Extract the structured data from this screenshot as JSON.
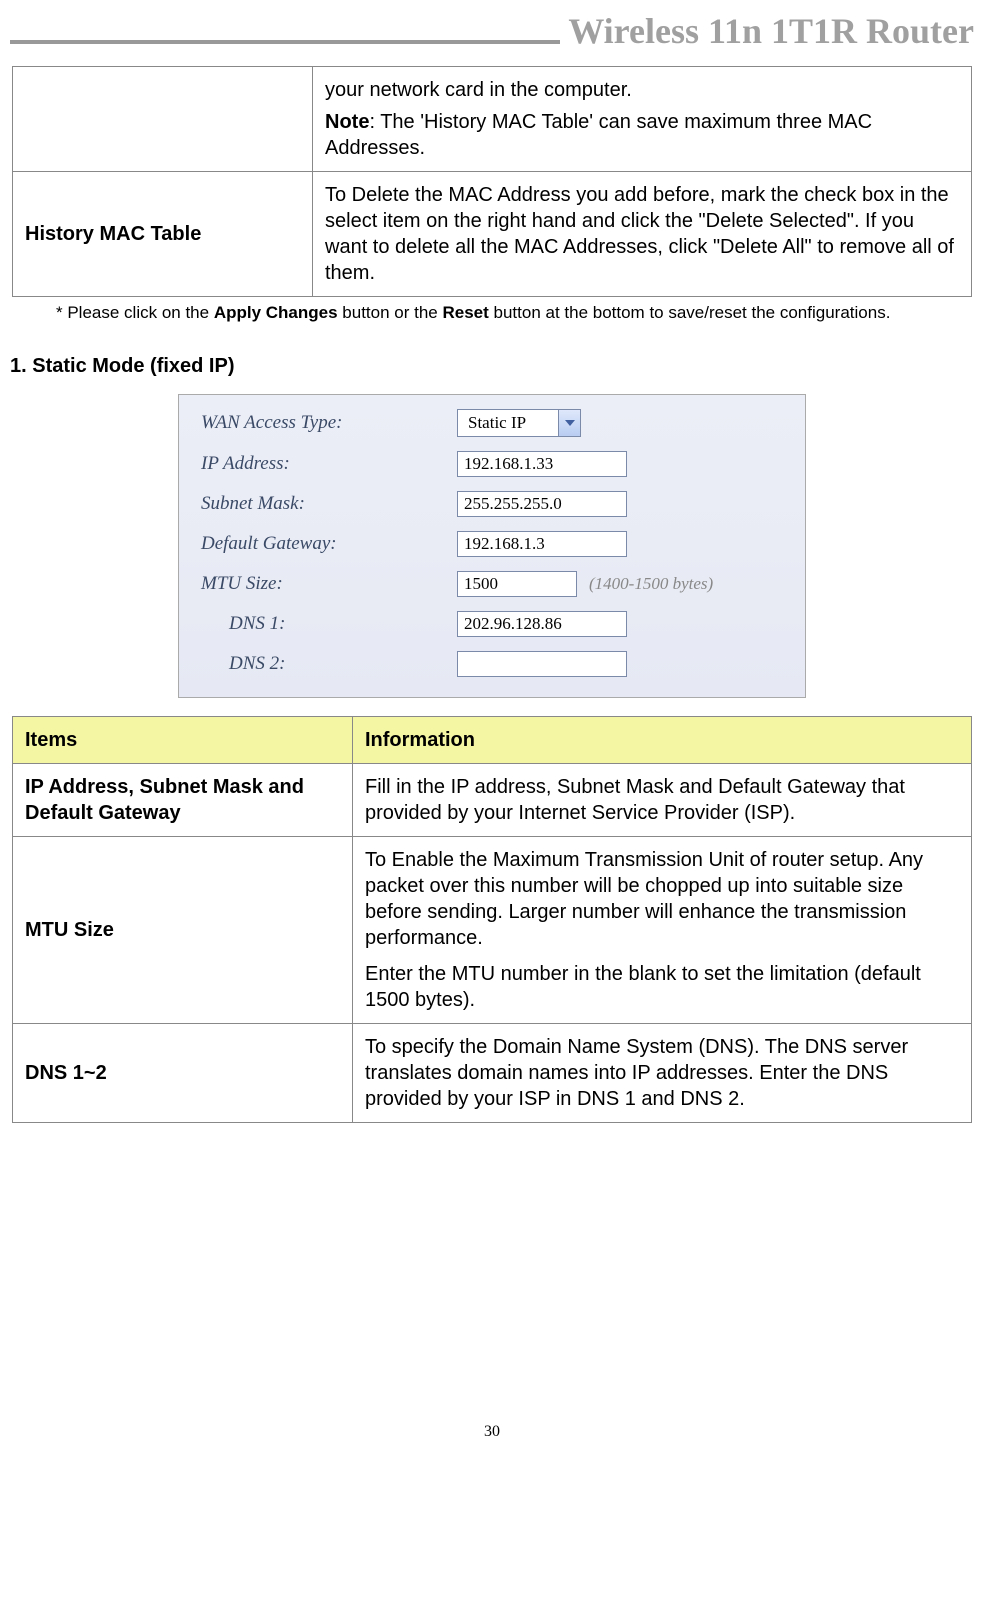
{
  "header": {
    "title": "Wireless 11n 1T1R Router"
  },
  "topTable": {
    "row1": {
      "label": "",
      "text1": "your network card in the computer.",
      "noteLabel": "Note",
      "noteText": ": The 'History MAC Table' can save maximum three MAC Addresses."
    },
    "row2": {
      "label": "History MAC Table",
      "text": "To Delete the MAC Address you add before, mark the check box in the select item on the right hand and click the \"Delete Selected\". If you want to delete all the MAC Addresses, click \"Delete All\" to remove all of them."
    }
  },
  "footnote": {
    "pre": "* Please click on the ",
    "b1": "Apply Changes",
    "mid": " button or the ",
    "b2": "Reset",
    "post": " button at the bottom to save/reset the configurations."
  },
  "sectionHeading": "1. Static Mode (fixed IP)",
  "form": {
    "wanLabel": "WAN Access Type:",
    "wanValue": "Static IP",
    "ipLabel": "IP Address:",
    "ipValue": "192.168.1.33",
    "maskLabel": "Subnet Mask:",
    "maskValue": "255.255.255.0",
    "gwLabel": "Default Gateway:",
    "gwValue": "192.168.1.3",
    "mtuLabel": "MTU Size:",
    "mtuValue": "1500",
    "mtuHint": "(1400-1500 bytes)",
    "dns1Label": "DNS 1:",
    "dns1Value": "202.96.128.86",
    "dns2Label": "DNS 2:",
    "dns2Value": ""
  },
  "staticTable": {
    "hItems": "Items",
    "hInfo": "Information",
    "r1label": "IP Address, Subnet Mask and Default Gateway",
    "r1text": "Fill in the IP address, Subnet Mask and Default Gateway that provided by your Internet Service Provider (ISP).",
    "r2label": "MTU Size",
    "r2text1": "To Enable the Maximum Transmission Unit of router setup. Any packet over this number will be chopped up into suitable size before sending. Larger number will enhance the transmission performance.",
    "r2text2": "Enter the MTU number in the blank to set the limitation (default 1500 bytes).",
    "r3label": "DNS 1~2",
    "r3text": "To specify the Domain Name System (DNS). The DNS server translates domain names into IP addresses. Enter the DNS provided by your ISP in DNS 1 and DNS 2."
  },
  "pageNumber": "30"
}
